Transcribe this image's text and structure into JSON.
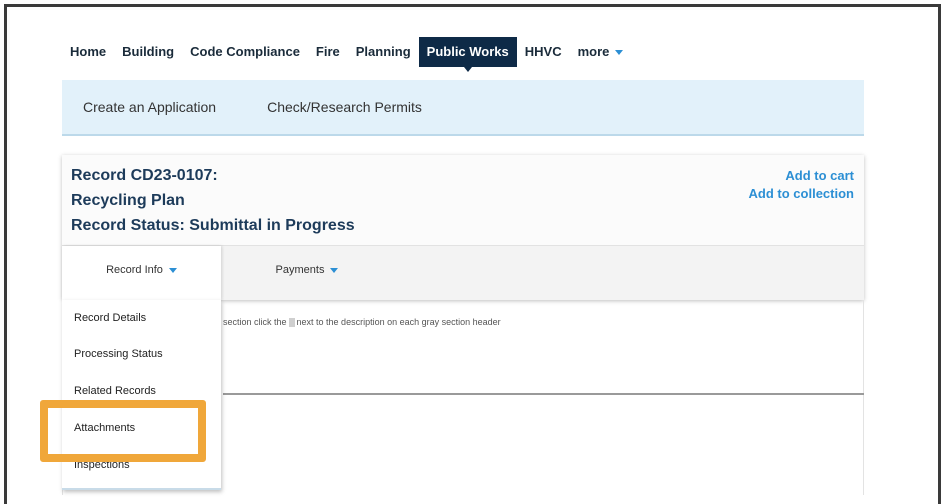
{
  "topnav": {
    "tabs": [
      {
        "label": "Home"
      },
      {
        "label": "Building"
      },
      {
        "label": "Code Compliance"
      },
      {
        "label": "Fire"
      },
      {
        "label": "Planning"
      },
      {
        "label": "Public Works",
        "active": true
      },
      {
        "label": "HHVC"
      },
      {
        "label": "more"
      }
    ]
  },
  "subnav": {
    "links": [
      "Create an Application",
      "Check/Research Permits"
    ]
  },
  "record": {
    "id_line": "Record CD23-0107:",
    "type_line": "Recycling Plan",
    "status_line": "Record Status: Submittal in Progress",
    "actions": [
      "Add to cart",
      "Add to collection"
    ]
  },
  "record_tabs": [
    "Record Info",
    "Payments"
  ],
  "dropdown": {
    "items": [
      "Record Details",
      "Processing Status",
      "Related Records",
      "Attachments",
      "Inspections"
    ]
  },
  "hint": {
    "before": "section click the",
    "after": "next to the description on each gray section header"
  },
  "colors": {
    "active_tab_bg": "#0e2a47",
    "accent_blue": "#2c8fd4",
    "subnav_bg": "#e2f1fa",
    "highlight": "#f0a73a"
  }
}
